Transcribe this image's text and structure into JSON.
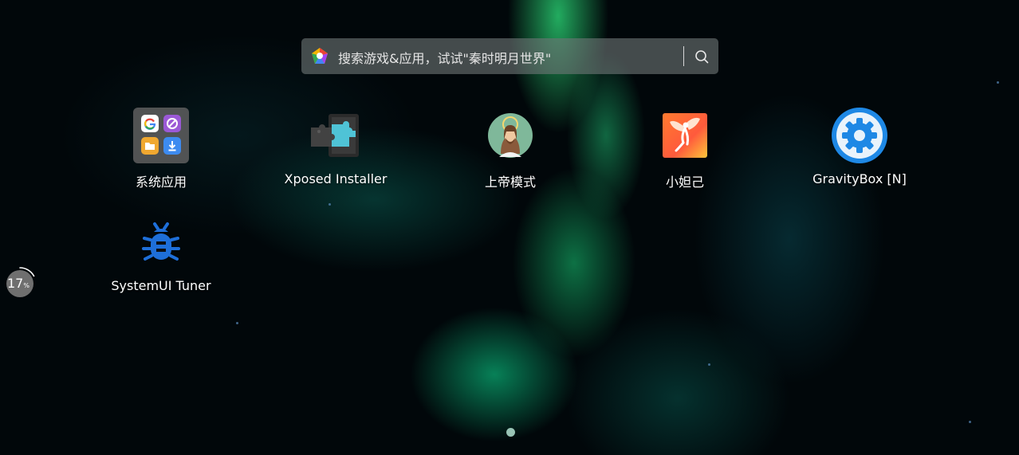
{
  "search": {
    "placeholder": "搜索游戏&应用，试试\"秦时明月世界\"",
    "logo_icon": "multicolor-pentagon-logo",
    "search_icon": "magnifier-icon"
  },
  "apps": [
    {
      "label": "系统应用",
      "icon": "system-apps-folder-icon"
    },
    {
      "label": "Xposed Installer",
      "icon": "xposed-puzzle-icon"
    },
    {
      "label": "上帝模式",
      "icon": "god-mode-jesus-icon"
    },
    {
      "label": "小妲己",
      "icon": "fairy-icon"
    },
    {
      "label": "GravityBox [N]",
      "icon": "gear-icon"
    },
    {
      "label": "SystemUI Tuner",
      "icon": "bug-icon"
    }
  ],
  "memory_widget": {
    "value": "17",
    "unit": "%",
    "usage_fraction": 0.17
  },
  "pager": {
    "current_page": 1,
    "total_pages": 1
  },
  "colors": {
    "search_bg": "#6e7676",
    "gravitybox_blue": "#1e88e5",
    "tuner_blue": "#1e6fd9",
    "page_dot": "#aad7c8"
  }
}
